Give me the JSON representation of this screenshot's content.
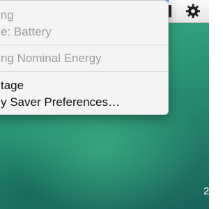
{
  "menu": {
    "items": [
      {
        "label": "ing"
      },
      {
        "label": "e: Battery"
      },
      {
        "label": "ng Nominal Energy"
      },
      {
        "label": "tage"
      },
      {
        "label": "y Saver Preferences…"
      }
    ]
  },
  "desktop": {
    "clock_fragment": "2"
  },
  "menubar": {
    "icons": [
      "battery-icon",
      "gear-icon"
    ]
  },
  "colors": {
    "accent": "#4a8df8",
    "menu_bg": "#f4f4f4",
    "dim_text": "#9c9c9c",
    "desktop": "#2e9a78"
  }
}
